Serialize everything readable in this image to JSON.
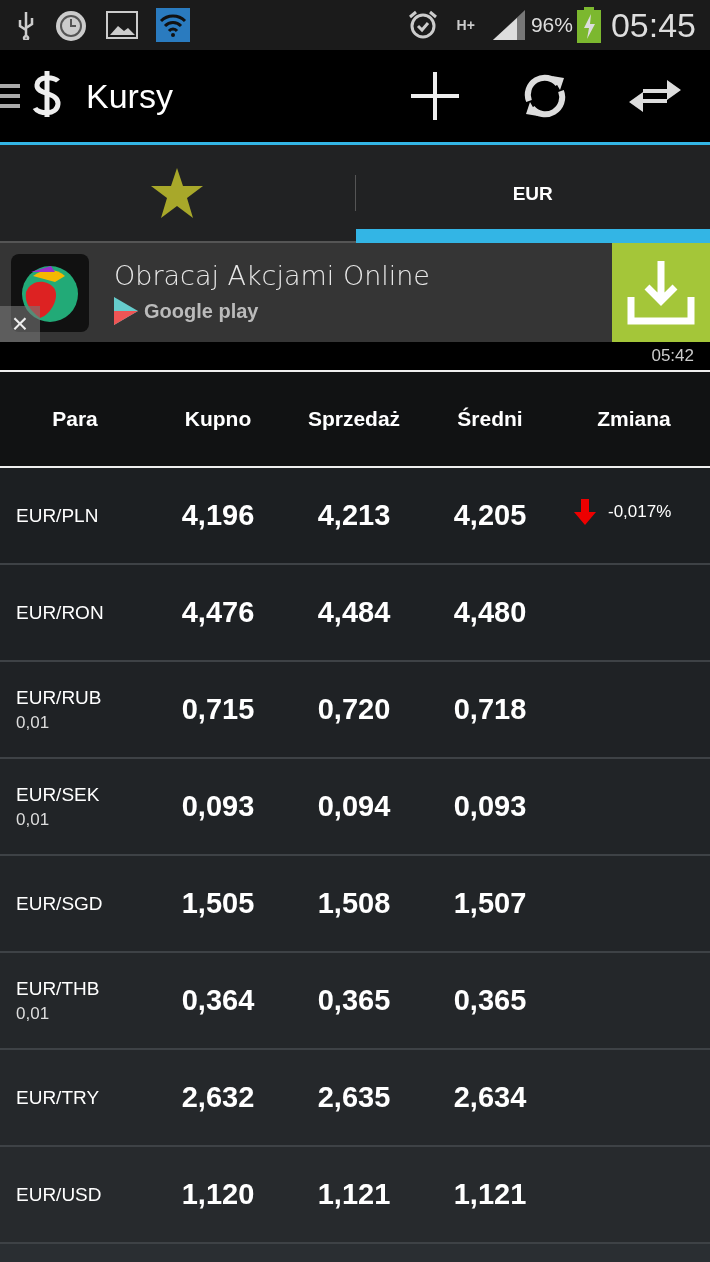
{
  "status_bar": {
    "network": "H+",
    "battery": "96%",
    "time": "05:45"
  },
  "action_bar": {
    "title": "Kursy"
  },
  "tabs": [
    {
      "kind": "star",
      "selected": false
    },
    {
      "kind": "text",
      "label": "EUR",
      "selected": true
    }
  ],
  "ad": {
    "title": "Obracaj Akcjami Online",
    "store": "Google play",
    "close": "×",
    "time": "05:42"
  },
  "table": {
    "columns": [
      "Para",
      "Kupno",
      "Sprzedaż",
      "Średni",
      "Zmiana"
    ],
    "rows": [
      {
        "pair": "EUR/PLN",
        "buy": "4,196",
        "sell": "4,213",
        "mid": "4,205",
        "change": {
          "kind": "down",
          "text": "-0,017%"
        }
      },
      {
        "pair": "EUR/RON",
        "buy": "4,476",
        "sell": "4,484",
        "mid": "4,480"
      },
      {
        "pair": "EUR/RUB",
        "unit": "0,01",
        "buy": "0,715",
        "sell": "0,720",
        "mid": "0,718"
      },
      {
        "pair": "EUR/SEK",
        "unit": "0,01",
        "buy": "0,093",
        "sell": "0,094",
        "mid": "0,093"
      },
      {
        "pair": "EUR/SGD",
        "buy": "1,505",
        "sell": "1,508",
        "mid": "1,507"
      },
      {
        "pair": "EUR/THB",
        "unit": "0,01",
        "buy": "0,364",
        "sell": "0,365",
        "mid": "0,365"
      },
      {
        "pair": "EUR/TRY",
        "buy": "2,632",
        "sell": "2,635",
        "mid": "2,634"
      },
      {
        "pair": "EUR/USD",
        "buy": "1,120",
        "sell": "1,121",
        "mid": "1,121"
      }
    ]
  }
}
